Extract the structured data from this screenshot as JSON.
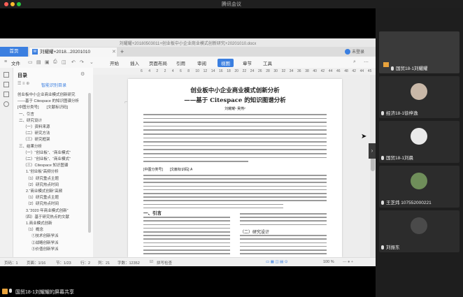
{
  "meeting": {
    "title": "腾讯会议",
    "share_label": "国贸18-1刘耀耀的屏幕共享"
  },
  "wps": {
    "doc_title": "刘耀耀+20180503011+创业板中小企业商业模式创新研究+20201010.docx",
    "tabs": {
      "home": "首页",
      "doc": "刘耀耀+2018...20201010"
    },
    "login": "未登录",
    "menu": {
      "file": "文件",
      "items": [
        "开始",
        "插入",
        "页面布局",
        "引用",
        "审阅",
        "视图",
        "章节",
        "工具"
      ],
      "active": "视图"
    },
    "ruler": [
      "6",
      "4",
      "2",
      "2",
      "4",
      "6",
      "8",
      "10",
      "12",
      "14",
      "16",
      "18",
      "20",
      "22",
      "24",
      "26",
      "28",
      "30",
      "32",
      "34",
      "36",
      "38",
      "40",
      "42",
      "44",
      "46",
      "48",
      "42",
      "44",
      "45"
    ],
    "toc": {
      "title": "目录",
      "smart": "智能识别目录",
      "items": [
        "创业板中小企业商业模式创新研究",
        "——基于 Citespace 的知识图谱分析",
        "[中图分类号]　　[文献标识码]",
        "一、引言",
        "二、研究设计",
        "（一）资料来源",
        "（二）研究方法",
        "（三）研究框架",
        "三、结果分析",
        "（一）“创业板”、“商业模式”",
        "（二）“创业板”、“商业模式”",
        "（三）Citespace 知识图谱",
        "1.“创业板”高频分析",
        "（1）研究重点主题",
        "（2）研究热点时间",
        "2.“商业模式创新”高频",
        "（1）研究重点主题",
        "（2）研究热点时间",
        "3.“2020 年商业模式创新”",
        "（四）基于研究热点的文献",
        "1.商业模式创新",
        "（1）概念",
        "①技术创新学派",
        "②战略创新学派",
        "③价值创新学派"
      ]
    },
    "page": {
      "title": "创业板中小企业商业模式创新分析",
      "subtitle": "——基于 Citespace 的知识图谱分析",
      "authors": "刘耀耀¹ 吴燕²",
      "abstract_label": "[中图分类号]　　[文献标识码] A",
      "section1": "一、引言",
      "section2": "（二）研究设计"
    },
    "status": {
      "page": "页码：1",
      "pages": "页面：1/16",
      "section": "节：1/23",
      "row": "行：2",
      "col": "列：21",
      "words": "字数：12352",
      "spell": "拼写检查",
      "zoom": "100 %"
    }
  },
  "participants": [
    {
      "name": "国贸18-1刘耀耀",
      "sharing": true
    },
    {
      "name": "经济18-1徐梓逸",
      "sharing": false
    },
    {
      "name": "国贸18-1刘晨",
      "sharing": false
    },
    {
      "name": "王芝炜 107552000221",
      "sharing": false
    },
    {
      "name": "刘振东",
      "sharing": false
    }
  ],
  "colors": {
    "accent": "#3b7fe0",
    "dark": "#1e1e1e"
  }
}
